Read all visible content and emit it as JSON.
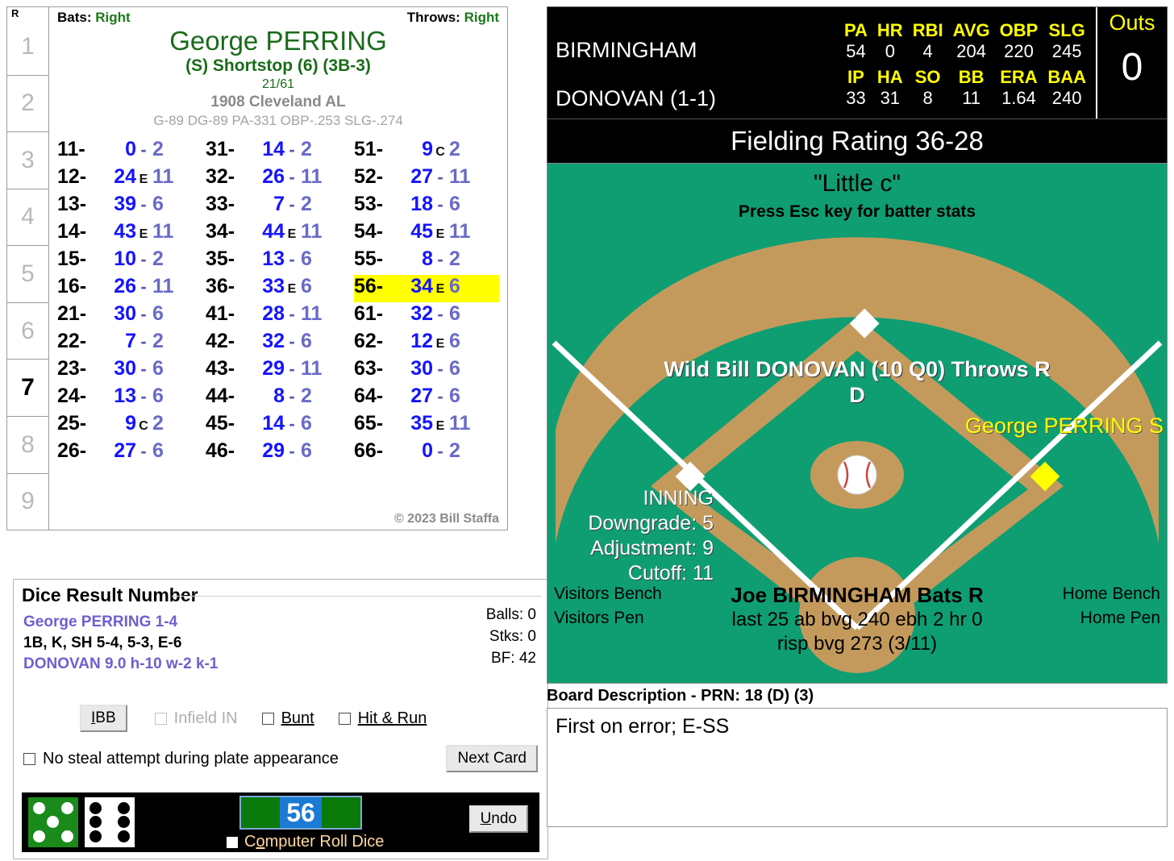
{
  "innings": {
    "header": "R",
    "cells": [
      "1",
      "2",
      "3",
      "4",
      "5",
      "6",
      "7",
      "8",
      "9"
    ],
    "active": "7"
  },
  "batter_card": {
    "bats_label": "Bats:",
    "bats_value": "Right",
    "throws_label": "Throws:",
    "throws_value": "Right",
    "name": "George PERRING",
    "position": "(S) Shortstop (6) (3B-3)",
    "fraction": "21/61",
    "team_year": "1908 Cleveland AL",
    "stat_line": "G-89 DG-89 PA-331 OBP-.253 SLG-.274",
    "copyright": "© 2023 Bill Staffa",
    "highlighted_roll": "56",
    "rolls": [
      {
        "code": "11-",
        "result": "0",
        "mod": "-",
        "num": "2"
      },
      {
        "code": "31-",
        "result": "14",
        "mod": "-",
        "num": "2"
      },
      {
        "code": "51-",
        "result": "9",
        "mod": "C",
        "num": "2"
      },
      {
        "code": "12-",
        "result": "24",
        "mod": "E",
        "num": "11"
      },
      {
        "code": "32-",
        "result": "26",
        "mod": "-",
        "num": "11"
      },
      {
        "code": "52-",
        "result": "27",
        "mod": "-",
        "num": "11"
      },
      {
        "code": "13-",
        "result": "39",
        "mod": "-",
        "num": "6"
      },
      {
        "code": "33-",
        "result": "7",
        "mod": "-",
        "num": "2"
      },
      {
        "code": "53-",
        "result": "18",
        "mod": "-",
        "num": "6"
      },
      {
        "code": "14-",
        "result": "43",
        "mod": "E",
        "num": "11"
      },
      {
        "code": "34-",
        "result": "44",
        "mod": "E",
        "num": "11"
      },
      {
        "code": "54-",
        "result": "45",
        "mod": "E",
        "num": "11"
      },
      {
        "code": "15-",
        "result": "10",
        "mod": "-",
        "num": "2"
      },
      {
        "code": "35-",
        "result": "13",
        "mod": "-",
        "num": "6"
      },
      {
        "code": "55-",
        "result": "8",
        "mod": "-",
        "num": "2"
      },
      {
        "code": "16-",
        "result": "26",
        "mod": "-",
        "num": "11"
      },
      {
        "code": "36-",
        "result": "33",
        "mod": "E",
        "num": "6"
      },
      {
        "code": "56-",
        "result": "34",
        "mod": "E",
        "num": "6"
      },
      {
        "code": "21-",
        "result": "30",
        "mod": "-",
        "num": "6"
      },
      {
        "code": "41-",
        "result": "28",
        "mod": "-",
        "num": "11"
      },
      {
        "code": "61-",
        "result": "32",
        "mod": "-",
        "num": "6"
      },
      {
        "code": "22-",
        "result": "7",
        "mod": "-",
        "num": "2"
      },
      {
        "code": "42-",
        "result": "32",
        "mod": "-",
        "num": "6"
      },
      {
        "code": "62-",
        "result": "12",
        "mod": "E",
        "num": "6"
      },
      {
        "code": "23-",
        "result": "30",
        "mod": "-",
        "num": "6"
      },
      {
        "code": "43-",
        "result": "29",
        "mod": "-",
        "num": "11"
      },
      {
        "code": "63-",
        "result": "30",
        "mod": "-",
        "num": "6"
      },
      {
        "code": "24-",
        "result": "13",
        "mod": "-",
        "num": "6"
      },
      {
        "code": "44-",
        "result": "8",
        "mod": "-",
        "num": "2"
      },
      {
        "code": "64-",
        "result": "27",
        "mod": "-",
        "num": "6"
      },
      {
        "code": "25-",
        "result": "9",
        "mod": "C",
        "num": "2"
      },
      {
        "code": "45-",
        "result": "14",
        "mod": "-",
        "num": "6"
      },
      {
        "code": "65-",
        "result": "35",
        "mod": "E",
        "num": "11"
      },
      {
        "code": "26-",
        "result": "27",
        "mod": "-",
        "num": "6"
      },
      {
        "code": "46-",
        "result": "29",
        "mod": "-",
        "num": "6"
      },
      {
        "code": "66-",
        "result": "0",
        "mod": "-",
        "num": "2"
      }
    ]
  },
  "dice_panel": {
    "title": "Dice Result Number",
    "batter_line": "George PERRING  1-4",
    "result_line": "1B, K, SH 5-4, 5-3, E-6",
    "pitcher_line": "DONOVAN  9.0  h-10  w-2  k-1",
    "balls": "Balls: 0",
    "strikes": "Stks: 0",
    "bf": "BF: 42",
    "ibb_label": "IBB",
    "infield_in_label": "Infield IN",
    "bunt_label": "Bunt",
    "hit_and_run_label": "Hit & Run",
    "no_steal_label": "No steal attempt during plate appearance",
    "next_card_label": "Next Card",
    "computer_roll_label": "Computer Roll Dice",
    "undo_label": "Undo",
    "roll_value": "56",
    "die1_pips": "5",
    "die2_pips": "6"
  },
  "scoreboard": {
    "team": "BIRMINGHAM",
    "pitcher": "DONOVAN (1-1)",
    "batter_headers": [
      "PA",
      "HR",
      "RBI",
      "AVG",
      "OBP",
      "SLG"
    ],
    "batter_values": [
      "54",
      "0",
      "4",
      "204",
      "220",
      "245"
    ],
    "pitcher_headers": [
      "IP",
      "HA",
      "SO",
      "BB",
      "ERA",
      "BAA"
    ],
    "pitcher_values": [
      "33",
      "31",
      "8",
      "11",
      "1.64",
      "240"
    ],
    "outs_label": "Outs",
    "outs_value": "0"
  },
  "field": {
    "fielding_rating": "Fielding Rating 36-28",
    "little_c": "\"Little c\"",
    "esc_hint": "Press Esc key for batter stats",
    "pitcher_name": "Wild Bill DONOVAN (10 Q0) Throws R",
    "pitcher_grade": "D",
    "runner": "George PERRING S",
    "inning_label": "INNING",
    "downgrade": "Downgrade: 5",
    "adjustment": "Adjustment: 9",
    "cutoff": "Cutoff: 11",
    "batter_name": "Joe BIRMINGHAM Bats R",
    "batter_last25": "last 25 ab bvg 240 ebh 2 hr 0",
    "batter_risp": "risp bvg 273 (3/11)",
    "visitors_bench": "Visitors Bench",
    "visitors_pen": "Visitors Pen",
    "home_bench": "Home Bench",
    "home_pen": "Home Pen"
  },
  "board": {
    "label": "Board Description - PRN: 18 (D) (3)",
    "text": "First on error; E-SS"
  }
}
